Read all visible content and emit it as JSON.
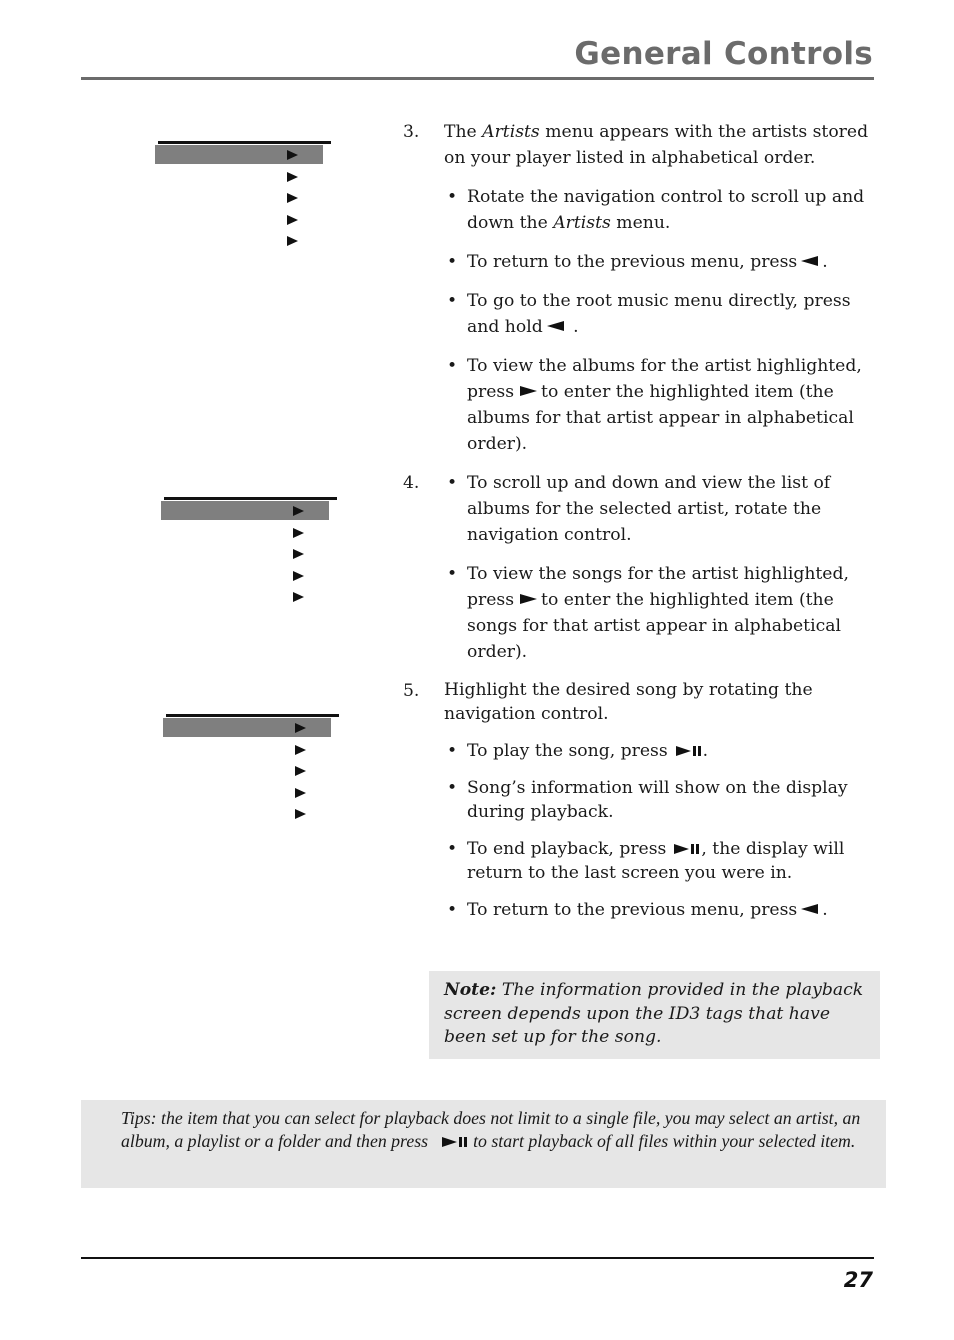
{
  "header": {
    "title": "General Controls"
  },
  "menus": [
    {
      "name": "artists-menu",
      "rows": 5,
      "highlighted_row": 1
    },
    {
      "name": "albums-menu",
      "rows": 5,
      "highlighted_row": 1
    },
    {
      "name": "songs-menu",
      "rows": 5,
      "highlighted_row": 1
    }
  ],
  "steps": {
    "s3": {
      "num": "3.",
      "text_a": "The ",
      "text_em": "Artists",
      "text_b": " menu appears with the artists stored on your player listed in alphabetical order.",
      "b1_a": "Rotate the navigation control to scroll up and down the ",
      "b1_em": "Artists",
      "b1_b": " menu.",
      "b2_a": "To return to the previous menu, press",
      "b2_b": ".",
      "b3_a": "To go to the root music menu directly, press and hold",
      "b3_b": ".",
      "b4_a": "To view the albums for the artist highlighted, press",
      "b4_b": "to enter the  highlighted item (the albums for that artist appear in alphabetical order)."
    },
    "s4": {
      "num": "4.",
      "b1": "To scroll up and down and view the list of albums for the selected artist, rotate the navigation control.",
      "b2_a": "To view the songs for the artist highlighted, press",
      "b2_b": "to enter the highlighted item (the songs for that artist appear in alphabetical order)."
    },
    "s5": {
      "num": "5.",
      "text": "Highlight the desired song by rotating the navigation control.",
      "b1_a": "To play the song, press",
      "b1_b": ".",
      "b2": "Song’s information will show on the display during playback.",
      "b3_a": "To end playback, press",
      "b3_b": ", the display will return to the last screen you  were in.",
      "b4_a": "To return to the previous menu, press",
      "b4_b": "."
    }
  },
  "note": {
    "label": "Note:",
    "text": " The information provided in the playback screen depends upon the ID3 tags that have been set up for the song."
  },
  "tips": {
    "text_a": "Tips: the item that you can select for playback does not limit to a single file, you may select an artist, an album, a playlist or a folder and then press",
    "text_b": "to start playback of all files within your selected item."
  },
  "footer": {
    "page_number": "27"
  },
  "icons": {
    "back": "left-triangle",
    "enter": "right-triangle",
    "play_pause": "play-pause"
  }
}
